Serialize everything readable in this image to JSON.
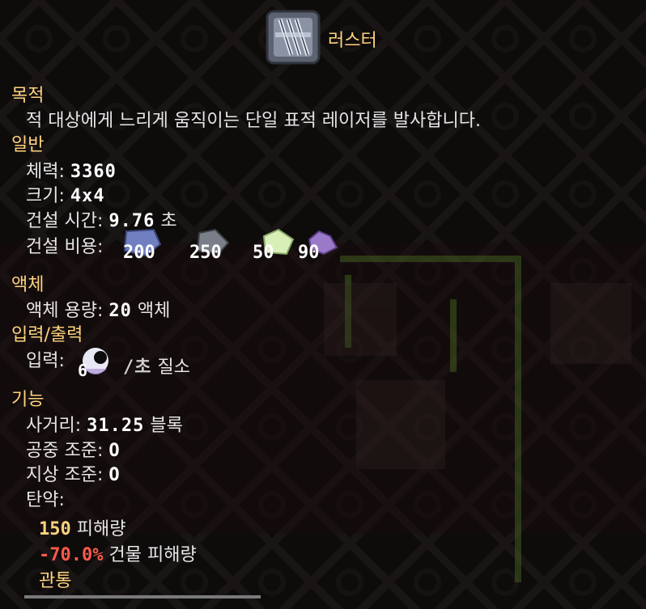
{
  "title": "러스터",
  "sections": {
    "purpose": {
      "heading": "목적",
      "text": "적 대상에게 느리게 움직이는 단일 표적 레이저를 발사합니다."
    },
    "general": {
      "heading": "일반",
      "health_label": "체력:",
      "health_value": "3360",
      "size_label": "크기:",
      "size_value": "4x4",
      "build_time_label": "건설 시간:",
      "build_time_value": "9.76",
      "build_time_unit": "초",
      "build_cost_label": "건설 비용:",
      "build_costs": [
        {
          "icon": "silicon-icon",
          "amount": "200"
        },
        {
          "icon": "tungsten-icon",
          "amount": "250"
        },
        {
          "icon": "oxide-icon",
          "amount": "50"
        },
        {
          "icon": "carbide-icon",
          "amount": "90"
        }
      ]
    },
    "liquids": {
      "heading": "액체",
      "capacity_label": "액체 용량:",
      "capacity_value": "20",
      "capacity_unit": "액체"
    },
    "io": {
      "heading": "입력/출력",
      "input_label": "입력:",
      "input_amount": "6",
      "input_rate": "/초",
      "input_name": "질소"
    },
    "function": {
      "heading": "기능",
      "range_label": "사거리:",
      "range_value": "31.25",
      "range_unit": "블록",
      "air_label": "공중 조준:",
      "air_value": "O",
      "ground_label": "지상 조준:",
      "ground_value": "O",
      "ammo_label": "탄약:",
      "damage_value": "150",
      "damage_label": "피해량",
      "building_damage_value": "-70.0%",
      "building_damage_label": "건물 피해량",
      "pierce_label": "관통"
    }
  },
  "colors": {
    "heading": "#ffd37f",
    "negative": "#ff5a4a",
    "text": "#e6e6e6"
  }
}
